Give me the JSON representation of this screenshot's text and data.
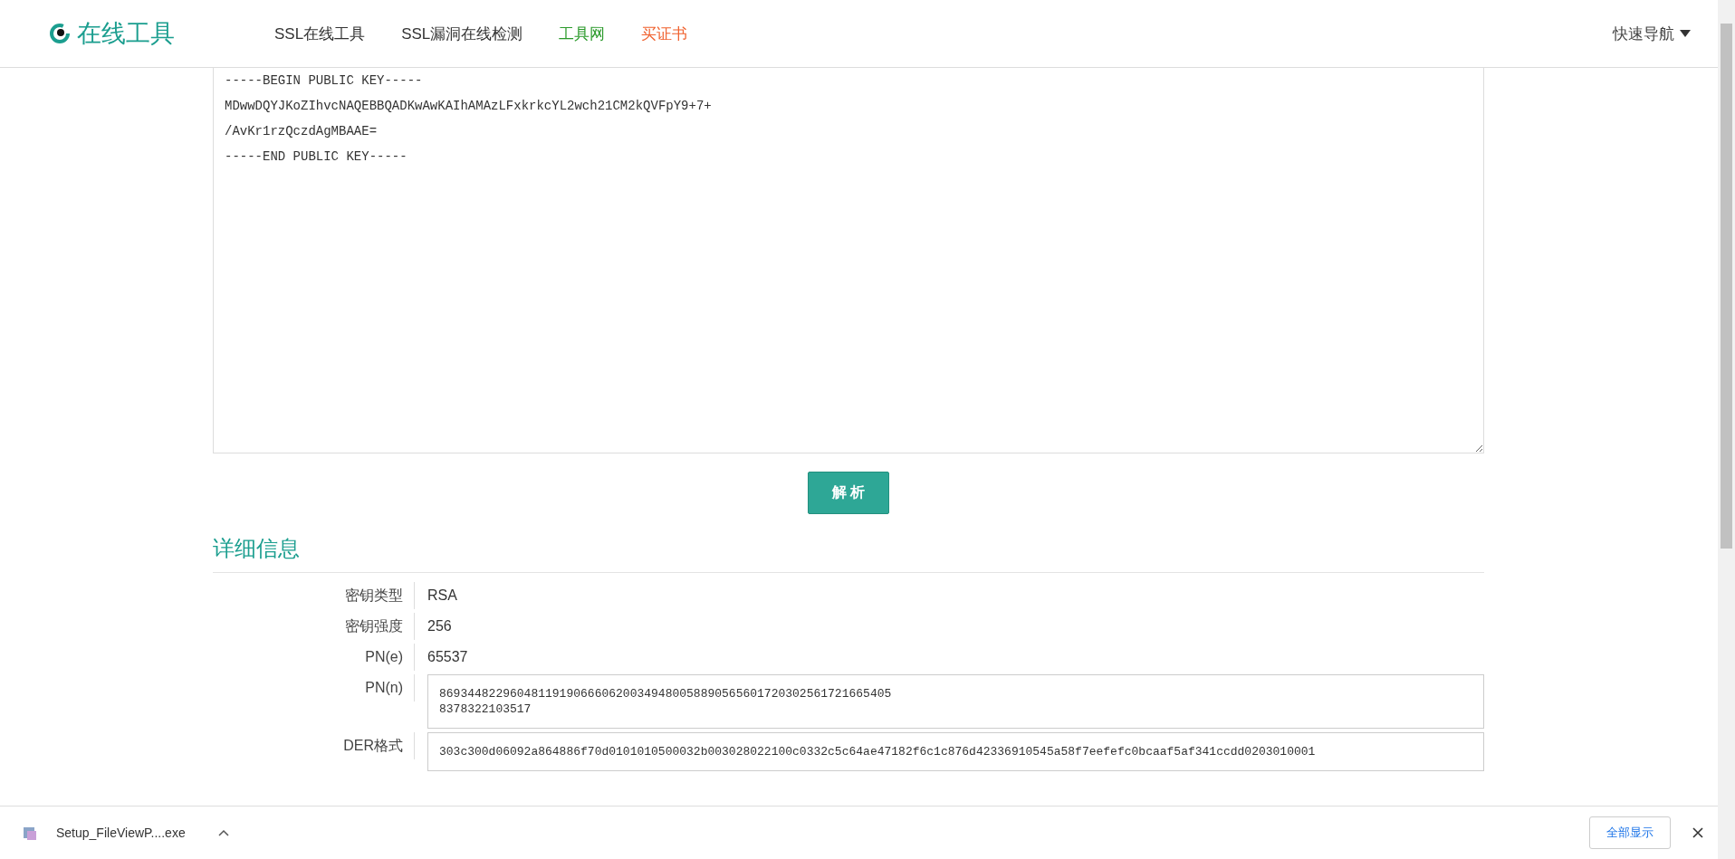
{
  "header": {
    "logo": "在线工具",
    "nav": [
      {
        "label": "SSL在线工具",
        "kind": "plain"
      },
      {
        "label": "SSL漏洞在线检测",
        "kind": "plain"
      },
      {
        "label": "工具网",
        "kind": "green"
      },
      {
        "label": "买证书",
        "kind": "orange"
      }
    ],
    "quick_nav": "快速导航"
  },
  "key_input": {
    "value": "-----BEGIN PUBLIC KEY-----\nMDwwDQYJKoZIhvcNAQEBBQADKwAwKAIhAMAzLFxkrkcYL2wch21CM2kQVFpY9+7+\n/AvKr1rzQczdAgMBAAE=\n-----END PUBLIC KEY-----"
  },
  "parse_button": "解 析",
  "details": {
    "title": "详细信息",
    "rows": [
      {
        "label": "密钥类型",
        "value": "RSA",
        "kind": "text"
      },
      {
        "label": "密钥强度",
        "value": "256",
        "kind": "text"
      },
      {
        "label": "PN(e)",
        "value": "65537",
        "kind": "text"
      },
      {
        "label": "PN(n)",
        "value": "8693448229604811919066606200349480058890565601720302561721665405\n8378322103517",
        "kind": "box"
      },
      {
        "label": "DER格式",
        "value": "303c300d06092a864886f70d0101010500032b003028022100c0332c5c64ae47182f6c1c876d42336910545a58f7eefefc0bcaaf5af341ccdd0203010001",
        "kind": "box"
      }
    ]
  },
  "download_bar": {
    "file": "Setup_FileViewP....exe",
    "show_all": "全部显示"
  }
}
